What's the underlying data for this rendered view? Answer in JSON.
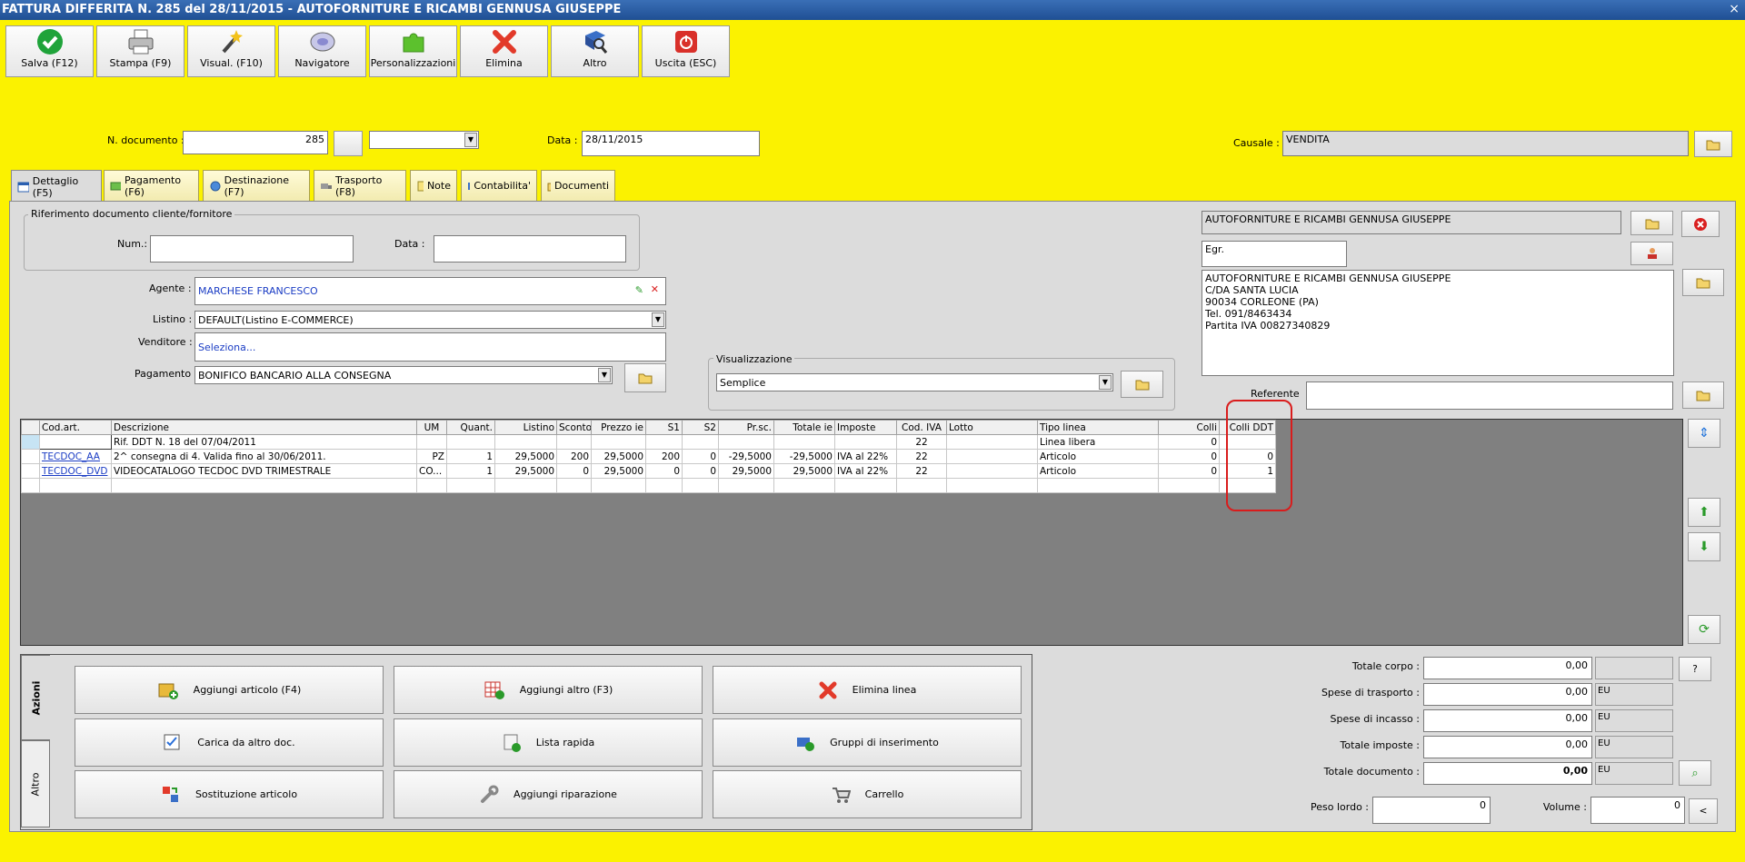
{
  "window": {
    "title": "FATTURA DIFFERITA N. 285 del 28/11/2015 - AUTOFORNITURE E RICAMBI GENNUSA GIUSEPPE",
    "close": "×"
  },
  "toolbar": [
    {
      "label": "Salva (F12)",
      "icon": "check-icon"
    },
    {
      "label": "Stampa (F9)",
      "icon": "printer-icon"
    },
    {
      "label": "Visual. (F10)",
      "icon": "magic-wand-icon"
    },
    {
      "label": "Navigatore",
      "icon": "compass-icon"
    },
    {
      "label": "Personalizzazioni",
      "icon": "puzzle-icon"
    },
    {
      "label": "Elimina",
      "icon": "delete-icon"
    },
    {
      "label": "Altro",
      "icon": "book-search-icon"
    },
    {
      "label": "Uscita (ESC)",
      "icon": "exit-icon"
    }
  ],
  "header": {
    "ndoc_label": "N. documento :",
    "ndoc_value": "285",
    "data_label": "Data :",
    "data_value": "28/11/2015",
    "causale_label": "Causale :",
    "causale_value": "VENDITA"
  },
  "tabs": [
    "Dettaglio (F5)",
    "Pagamento (F6)",
    "Destinazione (F7)",
    "Trasporto (F8)",
    "Note",
    "Contabilita'",
    "Documenti"
  ],
  "rif": {
    "title": "Riferimento documento cliente/fornitore",
    "num_label": "Num.:",
    "data_label": "Data :"
  },
  "agente": {
    "label": "Agente :",
    "value": "MARCHESE FRANCESCO"
  },
  "listino": {
    "label": "Listino :",
    "value": "DEFAULT(Listino E-COMMERCE)"
  },
  "venditore": {
    "label": "Venditore :",
    "value": "Seleziona..."
  },
  "pagamento": {
    "label": "Pagamento :",
    "value": "BONIFICO BANCARIO ALLA CONSEGNA"
  },
  "visualizzazione": {
    "title": "Visualizzazione",
    "value": "Semplice"
  },
  "cliente": {
    "name": "AUTOFORNITURE E RICAMBI GENNUSA GIUSEPPE",
    "title": "Egr.",
    "address": [
      "AUTOFORNITURE E RICAMBI GENNUSA GIUSEPPE",
      "C/DA SANTA LUCIA",
      "90034 CORLEONE (PA)",
      "Tel. 091/8463434",
      "Partita IVA 00827340829"
    ],
    "referente_label": "Referente"
  },
  "grid": {
    "columns": [
      "Cod.art.",
      "Descrizione",
      "UM",
      "Quant.",
      "Listino",
      "Sconto",
      "Prezzo ie",
      "S1",
      "S2",
      "Pr.sc.",
      "Totale ie",
      "Imposte",
      "Cod. IVA",
      "Lotto",
      "Tipo linea",
      "Colli",
      "Colli DDT"
    ],
    "rows": [
      [
        "",
        "Rif. DDT N. 18 del 07/04/2011",
        "",
        "",
        "",
        "",
        "",
        "",
        "",
        "",
        "",
        "",
        "22",
        "",
        "Linea libera",
        "0",
        ""
      ],
      [
        "TECDOC_AA",
        "2^ consegna di 4. Valida fino al 30/06/2011.",
        "PZ",
        "1",
        "29,5000",
        "200",
        "29,5000",
        "200",
        "0",
        "-29,5000",
        "-29,5000",
        "IVA al 22%",
        "22",
        "",
        "Articolo",
        "0",
        "0"
      ],
      [
        "TECDOC_DVD",
        "VIDEOCATALOGO TECDOC DVD TRIMESTRALE",
        "CO...",
        "1",
        "29,5000",
        "0",
        "29,5000",
        "0",
        "0",
        "29,5000",
        "29,5000",
        "IVA al 22%",
        "22",
        "",
        "Articolo",
        "0",
        "1"
      ],
      [
        "",
        "",
        "",
        "",
        "",
        "",
        "",
        "",
        "",
        "",
        "",
        "",
        "",
        "",
        "",
        "",
        ""
      ]
    ]
  },
  "azioni": {
    "tab1": "Azioni",
    "tab2": "Altro",
    "buttons": [
      "Aggiungi articolo (F4)",
      "Aggiungi altro (F3)",
      "Elimina linea",
      "Carica da altro doc.",
      "Lista rapida",
      "Gruppi di inserimento",
      "Sostituzione articolo",
      "Aggiungi riparazione",
      "Carrello"
    ]
  },
  "totali": {
    "corpo_label": "Totale corpo :",
    "corpo": "0,00",
    "help": "?",
    "trasporto_label": "Spese di trasporto :",
    "trasporto": "0,00",
    "incasso_label": "Spese di incasso :",
    "incasso": "0,00",
    "imposte_label": "Totale imposte :",
    "imposte": "0,00",
    "documento_label": "Totale documento :",
    "documento": "0,00",
    "currency": "EU",
    "peso_label": "Peso lordo :",
    "peso": "0",
    "volume_label": "Volume :",
    "volume": "0",
    "less": "<"
  }
}
